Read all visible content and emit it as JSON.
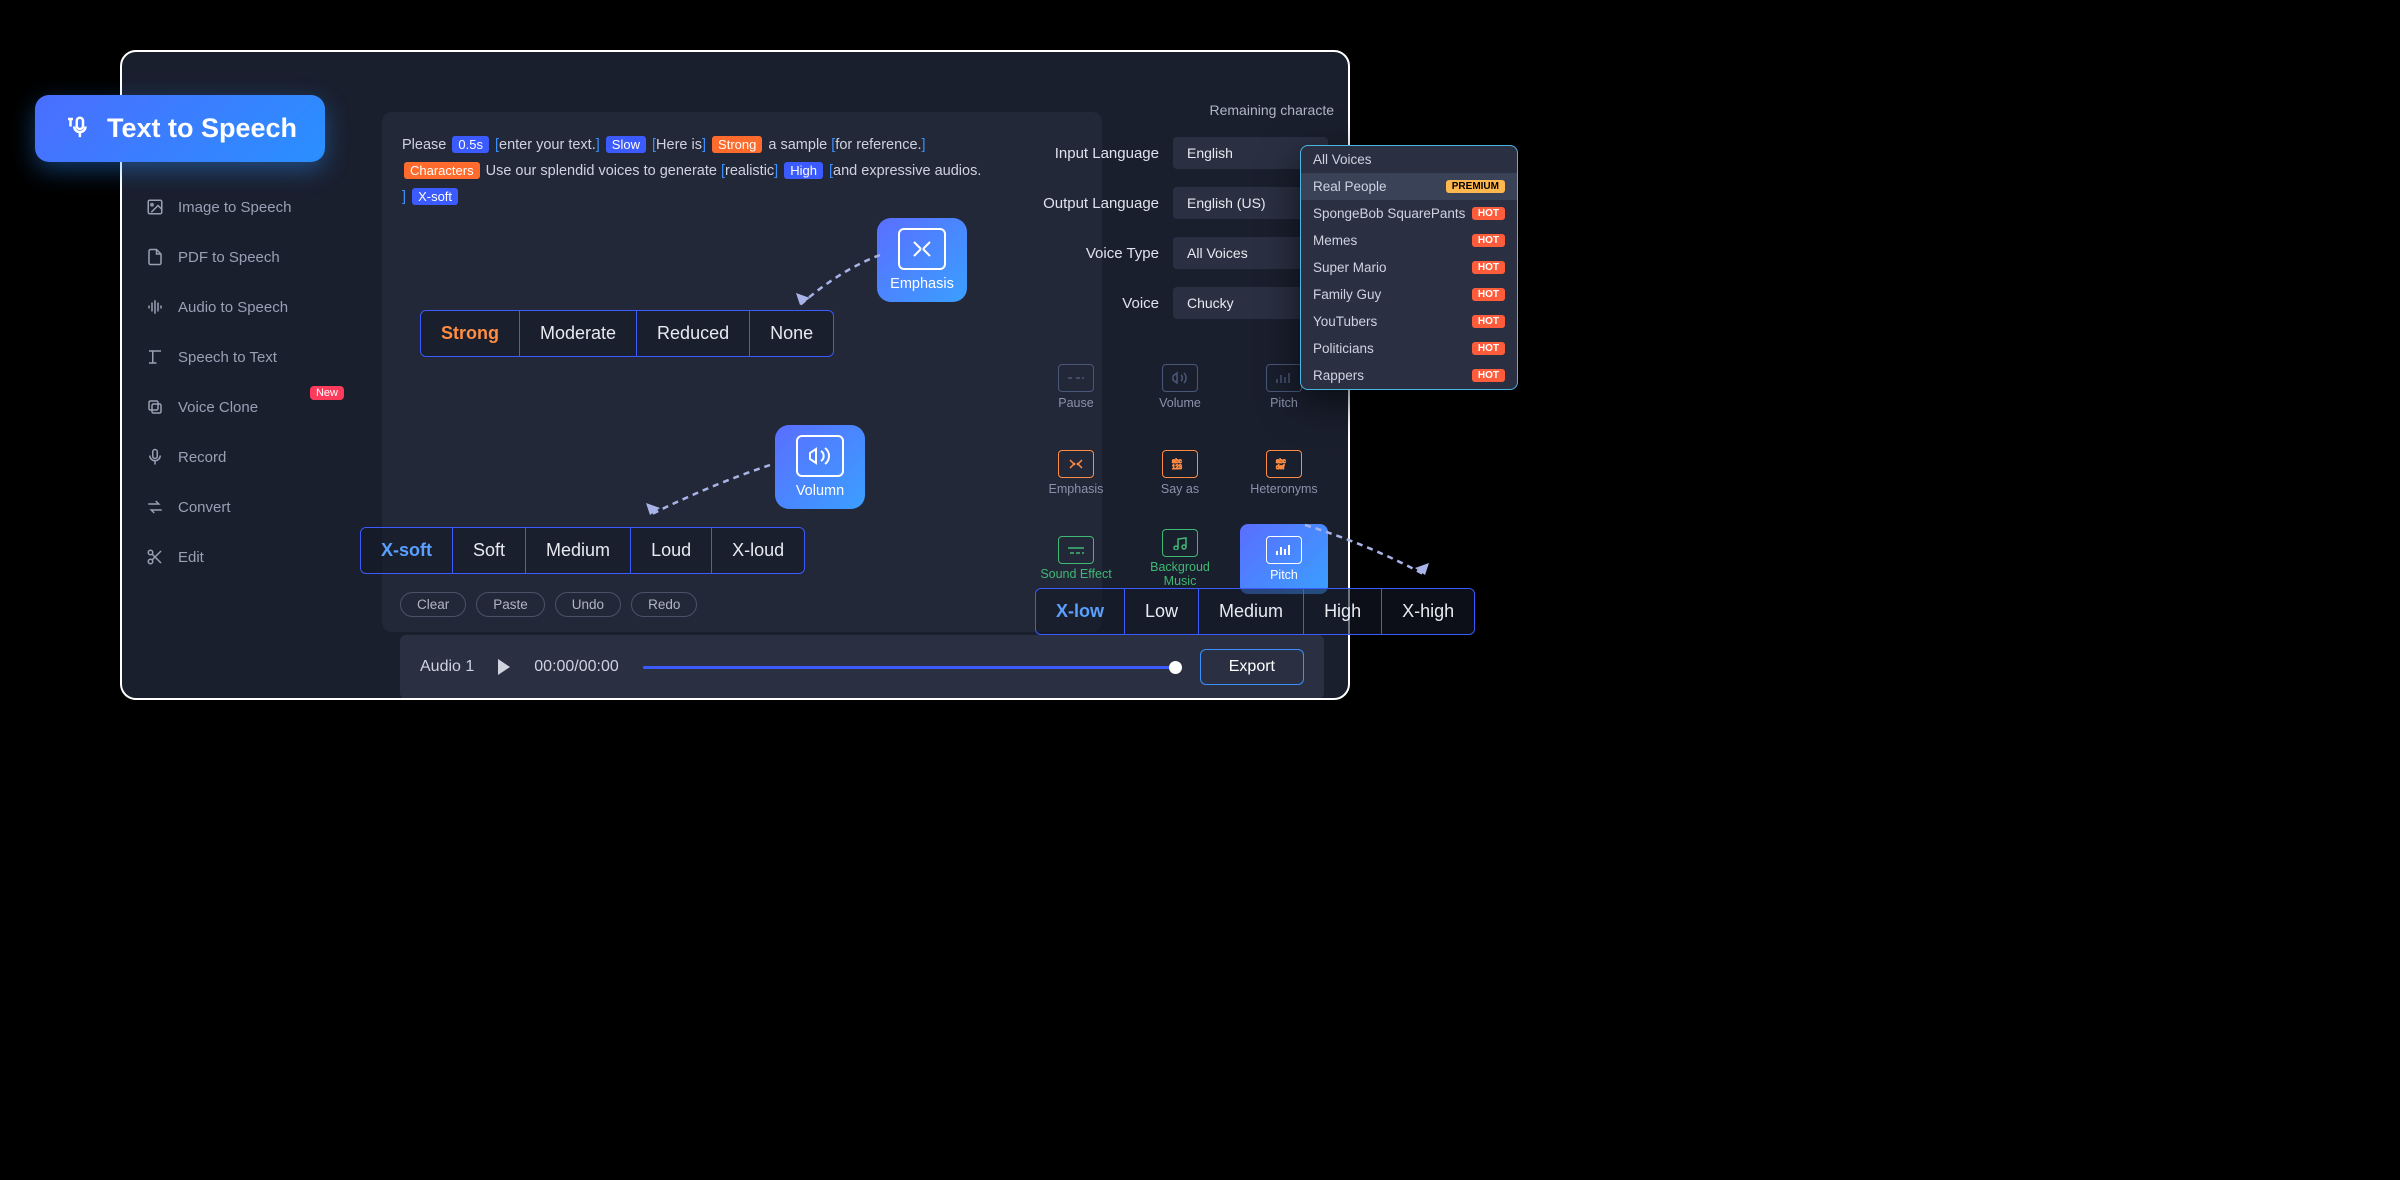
{
  "badge_label": "Text  to Speech",
  "remaining_label": "Remaining characte",
  "sidebar": {
    "items": [
      {
        "label": "Image to Speech"
      },
      {
        "label": "PDF to Speech"
      },
      {
        "label": "Audio to Speech"
      },
      {
        "label": "Speech to Text"
      },
      {
        "label": "Voice Clone",
        "badge": "New"
      },
      {
        "label": "Record"
      },
      {
        "label": "Convert"
      },
      {
        "label": "Edit"
      }
    ]
  },
  "editor": {
    "t1": "Please ",
    "tag_05s": "0.5s",
    "t2": "enter your text.",
    "tag_slow": "Slow",
    "t3": "Here is",
    "tag_strong": "Strong",
    "t4": " a sample ",
    "t5": "for reference.",
    "tag_characters": "Characters",
    "t6": " Use our splendid voices to generate ",
    "t7": "realistic",
    "tag_high": "High",
    "t8": "and expressive audios.",
    "tag_xsoft": "X-soft"
  },
  "callouts": {
    "emphasis": "Emphasis",
    "volumn": "Volumn"
  },
  "emphasis_options": [
    "Strong",
    "Moderate",
    "Reduced",
    "None"
  ],
  "volumn_options": [
    "X-soft",
    "Soft",
    "Medium",
    "Loud",
    "X-loud"
  ],
  "pitch_options": [
    "X-low",
    "Low",
    "Medium",
    "High",
    "X-high"
  ],
  "controls": {
    "input_language": {
      "label": "Input Language",
      "value": "English"
    },
    "output_language": {
      "label": "Output Language",
      "value": "English (US)"
    },
    "voice_type": {
      "label": "Voice Type",
      "value": "All Voices"
    },
    "voice": {
      "label": "Voice",
      "value": "Chucky"
    }
  },
  "tools": [
    {
      "label": "Pause"
    },
    {
      "label": "Volume"
    },
    {
      "label": "Pitch"
    },
    {
      "label": "Emphasis"
    },
    {
      "label": "Say as"
    },
    {
      "label": "Heteronyms"
    },
    {
      "label": "Sound Effect"
    },
    {
      "label": "Backgroud Music"
    },
    {
      "label": "Pitch"
    }
  ],
  "actions": {
    "clear": "Clear",
    "paste": "Paste",
    "undo": "Undo",
    "redo": "Redo"
  },
  "player": {
    "track": "Audio 1",
    "time": "00:00/00:00",
    "export": "Export"
  },
  "voice_dropdown": [
    {
      "label": "All Voices"
    },
    {
      "label": "Real People",
      "badge": "PREMIUM",
      "badge_class": "premium",
      "selected": true
    },
    {
      "label": "SpongeBob SquarePants",
      "badge": "HOT",
      "badge_class": "hot"
    },
    {
      "label": "Memes",
      "badge": "HOT",
      "badge_class": "hot"
    },
    {
      "label": "Super Mario",
      "badge": "HOT",
      "badge_class": "hot"
    },
    {
      "label": "Family Guy",
      "badge": "HOT",
      "badge_class": "hot"
    },
    {
      "label": "YouTubers",
      "badge": "HOT",
      "badge_class": "hot"
    },
    {
      "label": "Politicians",
      "badge": "HOT",
      "badge_class": "hot"
    },
    {
      "label": "Rappers",
      "badge": "HOT",
      "badge_class": "hot"
    }
  ]
}
